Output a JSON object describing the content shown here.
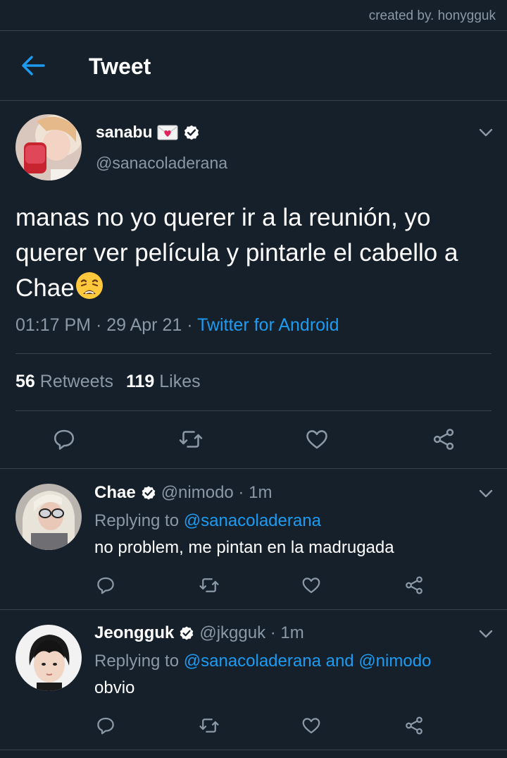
{
  "credit": "created by. honygguk",
  "header": {
    "title": "Tweet"
  },
  "colors": {
    "background": "#15202b",
    "accent": "#1d9bf0",
    "muted": "#8b98a5",
    "divider": "#38444d"
  },
  "main_tweet": {
    "name": "sanabu",
    "name_emoji": "love-letter-emoji",
    "handle": "@sanacoladerana",
    "text": "manas no yo querer ir a la reunión, yo querer ver película y pintarle el cabello a Chae",
    "trailing_emoji": "weary-face-emoji",
    "time": "01:17 PM",
    "date": "29 Apr 21",
    "source": "Twitter for Android",
    "retweets_count": "56",
    "retweets_label": "Retweets",
    "likes_count": "119",
    "likes_label": "Likes"
  },
  "replies": [
    {
      "name": "Chae",
      "handle": "@nimodo",
      "time": "1m",
      "replying_prefix": "Replying to",
      "mentions": [
        "@sanacoladerana"
      ],
      "text": "no problem, me pintan en la madrugada"
    },
    {
      "name": "Jeongguk",
      "handle": "@jkgguk",
      "time": "1m",
      "replying_prefix": "Replying to",
      "mentions": [
        "@sanacoladerana",
        "@nimodo"
      ],
      "mention_joiner": "and",
      "text": "obvio"
    }
  ]
}
